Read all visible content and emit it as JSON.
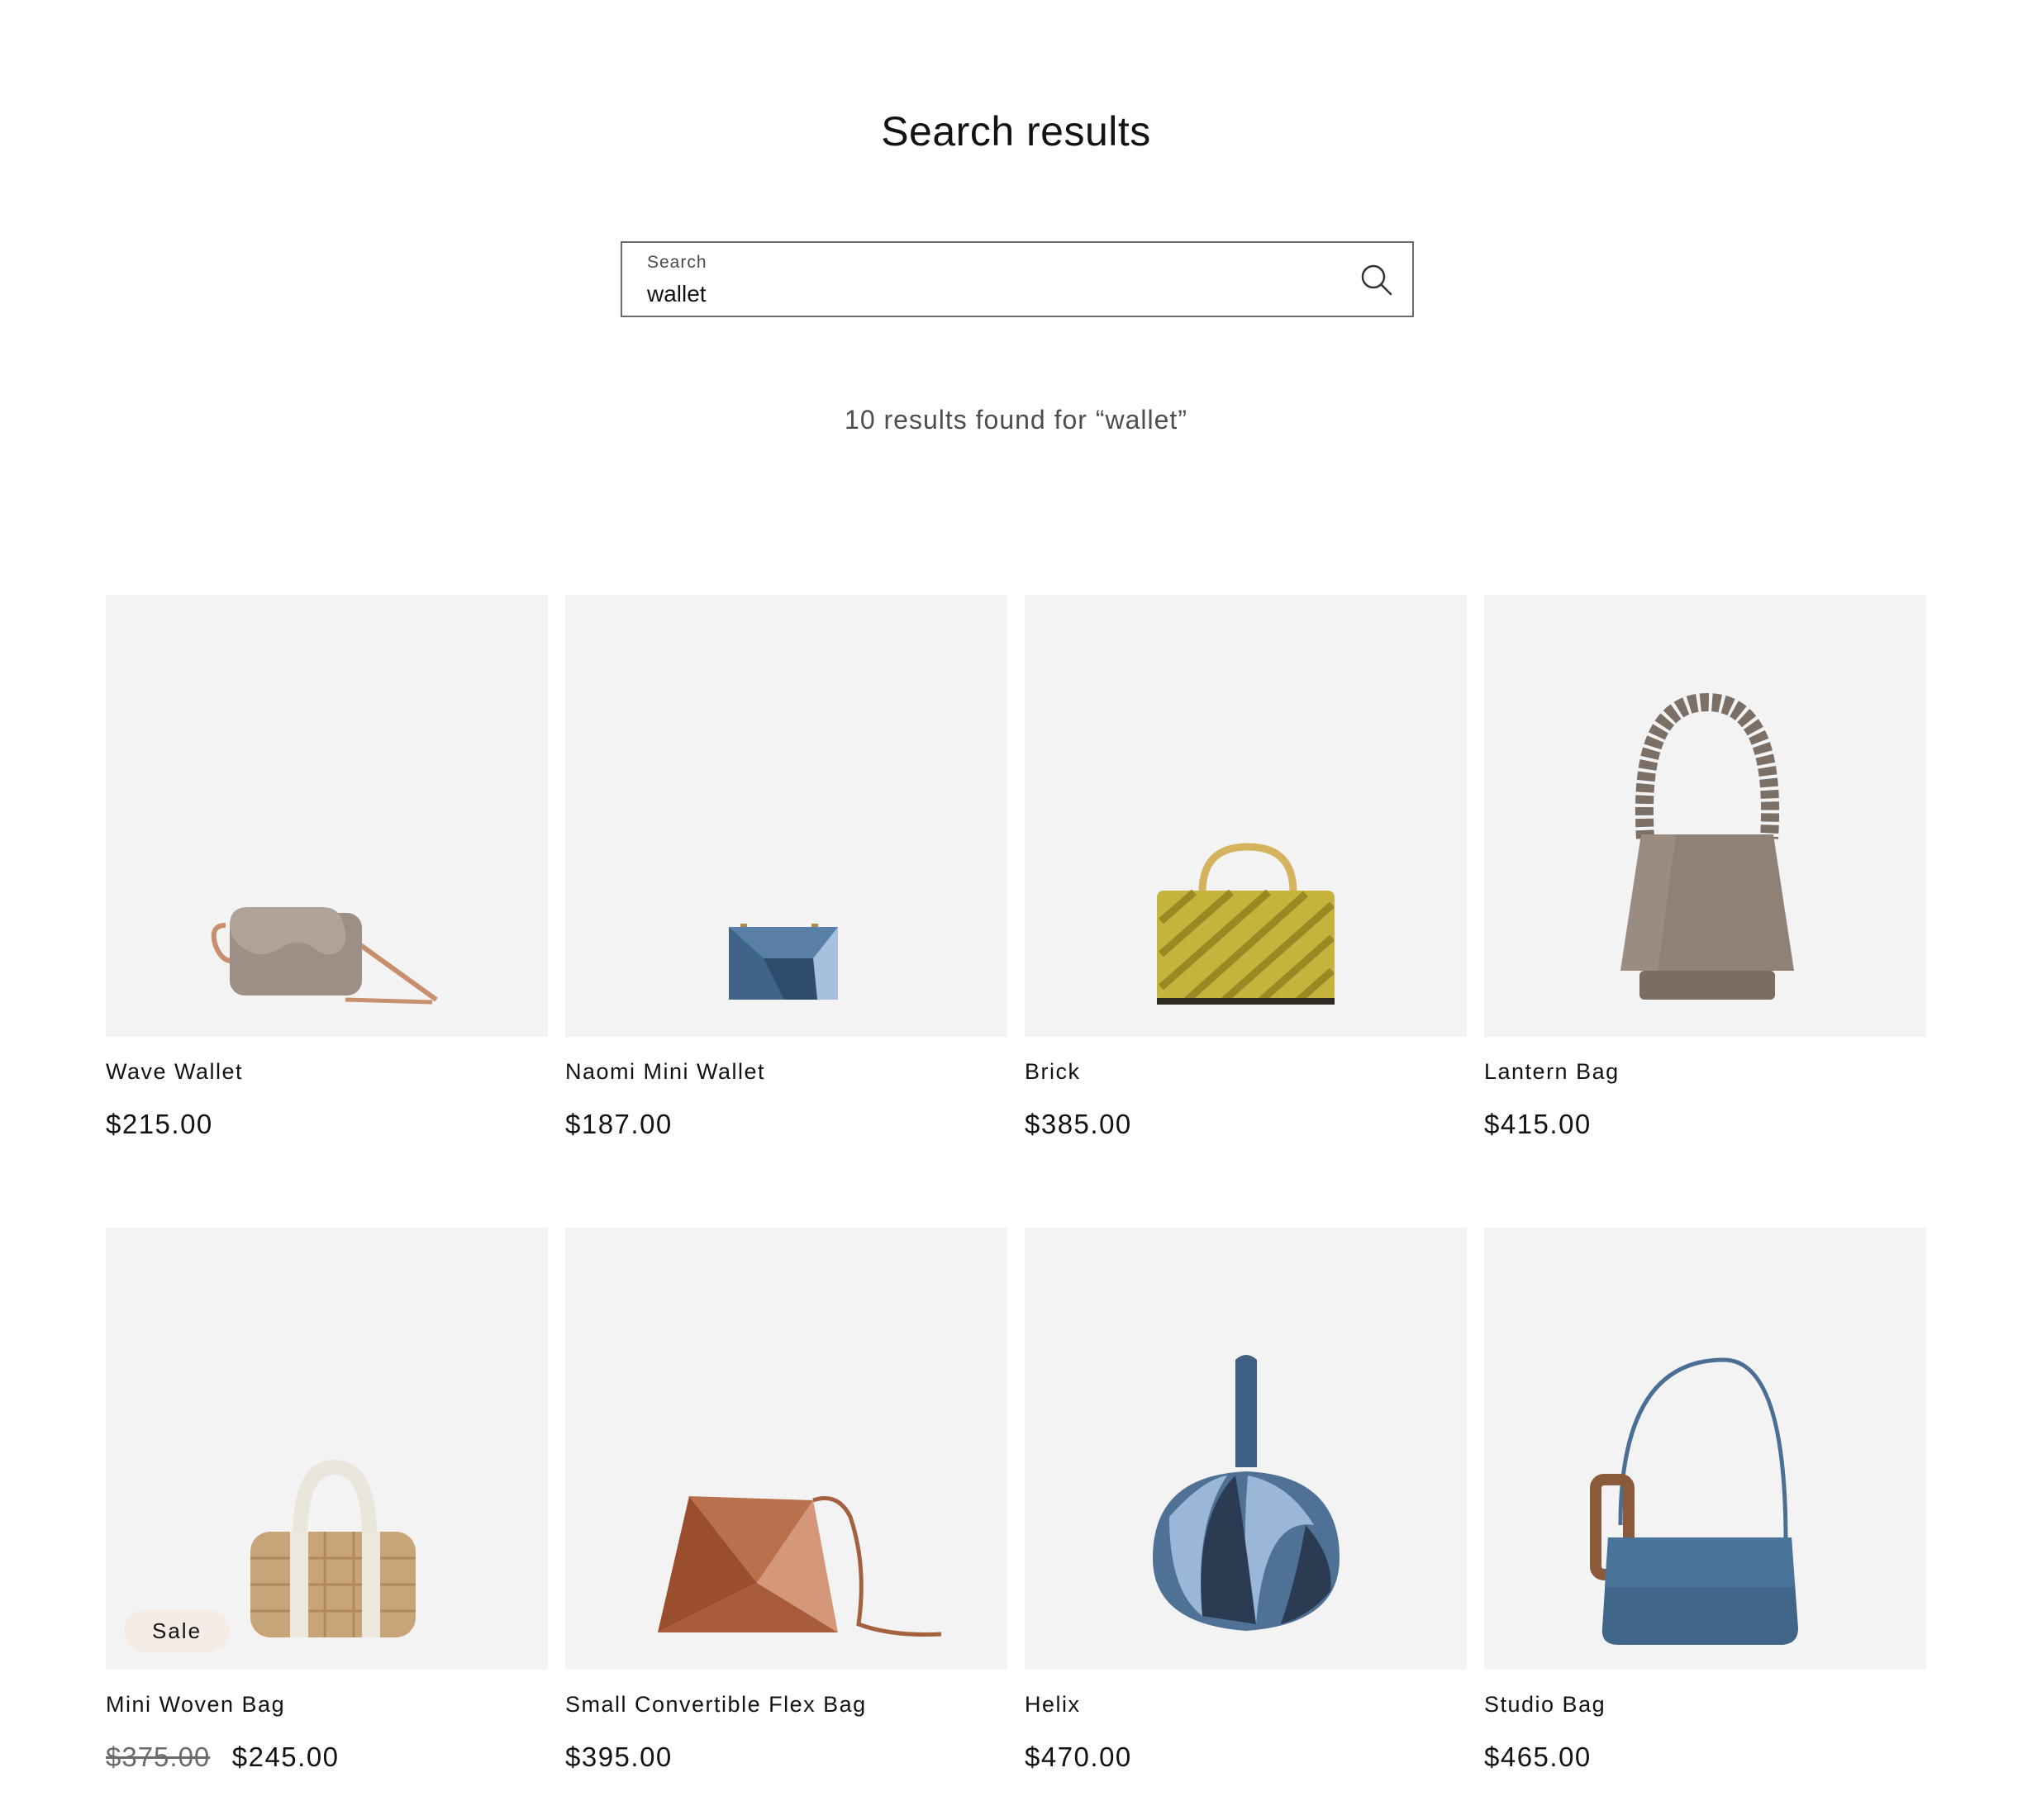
{
  "header": {
    "title": "Search results"
  },
  "search": {
    "label": "Search",
    "value": "wallet",
    "icon": "search-icon"
  },
  "results": {
    "summary": "10 results found for “wallet”"
  },
  "products": [
    {
      "name": "Wave Wallet",
      "price": "$215.00",
      "image": "wave-wallet-image"
    },
    {
      "name": "Naomi Mini Wallet",
      "price": "$187.00",
      "image": "naomi-mini-wallet-image"
    },
    {
      "name": "Brick",
      "price": "$385.00",
      "image": "brick-bag-image"
    },
    {
      "name": "Lantern Bag",
      "price": "$415.00",
      "image": "lantern-bag-image"
    },
    {
      "name": "Mini Woven Bag",
      "compare_price": "$375.00",
      "price": "$245.00",
      "badge": "Sale",
      "image": "mini-woven-bag-image"
    },
    {
      "name": "Small Convertible Flex Bag",
      "price": "$395.00",
      "image": "flex-bag-image"
    },
    {
      "name": "Helix",
      "price": "$470.00",
      "image": "helix-bag-image"
    },
    {
      "name": "Studio Bag",
      "price": "$465.00",
      "image": "studio-bag-image"
    }
  ],
  "colors": {
    "card_background": "#f3f3f3",
    "sale_badge": "#f6ece6",
    "text": "#121212"
  }
}
